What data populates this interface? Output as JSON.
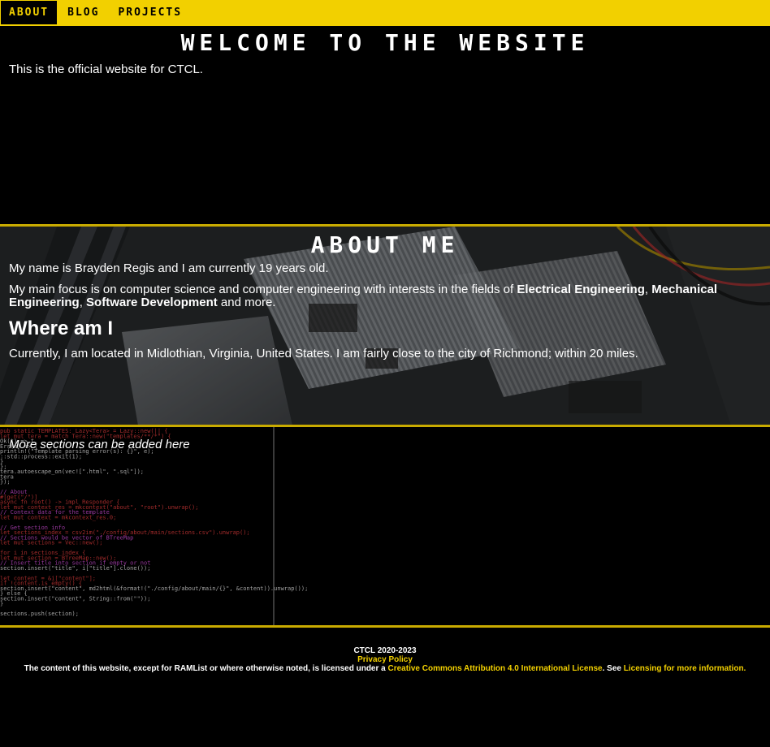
{
  "nav": {
    "items": [
      {
        "label": "About",
        "active": true
      },
      {
        "label": "Blog",
        "active": false
      },
      {
        "label": "Projects",
        "active": false
      }
    ]
  },
  "welcome": {
    "title": "Welcome to the website",
    "intro": "This is the official website for CTCL."
  },
  "about": {
    "title": "About me",
    "p1": "My name is Brayden Regis and I am currently 19 years old.",
    "p2_prefix": "My main focus is on computer science and computer engineering with interests in the fields of ",
    "field1": "Electrical Engineering",
    "sep1": ", ",
    "field2": "Mechanical Engineering",
    "sep2": ", ",
    "field3": "Software Development",
    "p2_suffix": " and more.",
    "where_heading": "Where am I",
    "p3": "Currently, I am located in Midlothian, Virginia, United States. I am fairly close to the city of Richmond; within 20 miles."
  },
  "more": {
    "text": "More sections can be added here"
  },
  "code_lines": [
    "pub static TEMPLATES: Lazy<Tera> = Lazy::new(|| {",
    "    let mut tera = match Tera::new(\"templates/**/*\") {",
    "        Ok(t) => t,",
    "        Err(e) => {",
    "            println!(\"Template parsing error(s): {}\", e);",
    "            ::std::process::exit(1);",
    "        }",
    "    };",
    "    tera.autoescape_on(vec![\".html\", \".sql\"]);",
    "    tera",
    "});",
    "",
    "// About",
    "#[get(\"/\")]",
    "async fn root() -> impl Responder {",
    "    let mut context_res = mkcontext(\"about\", \"root\").unwrap();",
    "    // Context data for the template",
    "    let mut context = mkcontext_res.0;",
    "",
    "    // Get section info",
    "    let sections_index = csv2im(\"./config/about/main/sections.csv\").unwrap();",
    "    // Sections would be vector of BTreeMap",
    "    let mut sections = Vec::new();",
    "",
    "    for i in sections_index {",
    "        let mut section = BTreeMap::new();",
    "        // Insert title into section if empty or not",
    "        section.insert(\"title\", i[\"title\"].clone());",
    "",
    "        let content = &i[\"content\"];",
    "        if !content.is_empty() {",
    "            section.insert(\"content\", md2html(&format!(\"./config/about/main/{}\", &content)).unwrap());",
    "        } else {",
    "            section.insert(\"content\", String::from(\"\"));",
    "        }",
    "",
    "        sections.push(section);"
  ],
  "footer": {
    "copyright": "CTCL 2020-2023",
    "privacy": "Privacy Policy",
    "license_prefix": "The content of this website, except for RAMList or where otherwise noted, is licensed under a ",
    "license_link": "Creative Commons Attribution 4.0 International License",
    "license_mid": ". See ",
    "licensing_link": "Licensing for more information."
  },
  "colors": {
    "accent": "#f2d000",
    "background": "#000000",
    "code_keyword": "#d93a3a",
    "code_comment": "#c84ad0",
    "code_string": "#f2d000",
    "code_text": "#d8d8d8"
  }
}
